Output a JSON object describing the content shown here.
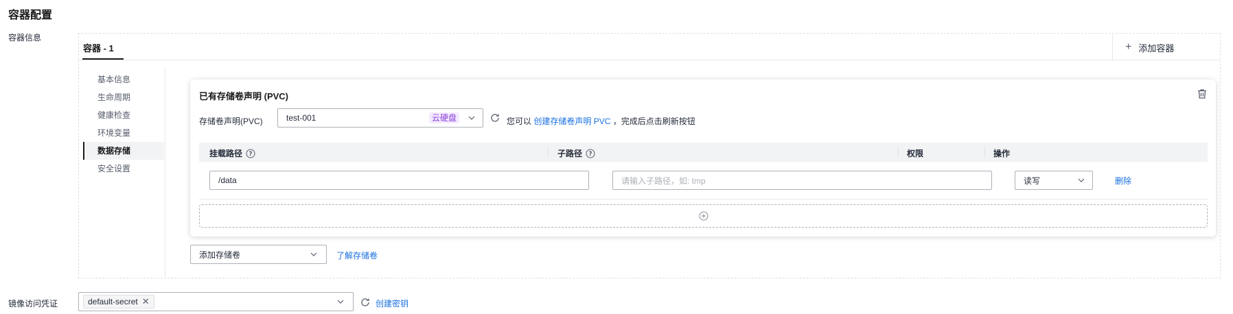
{
  "page": {
    "section_title": "容器配置"
  },
  "container_info": {
    "label": "容器信息",
    "tabs": [
      {
        "label": "容器 - 1",
        "active": true
      }
    ],
    "add_container_label": "添加容器"
  },
  "side_nav": {
    "items": [
      {
        "label": "基本信息",
        "active": false
      },
      {
        "label": "生命周期",
        "active": false
      },
      {
        "label": "健康检查",
        "active": false
      },
      {
        "label": "环境变量",
        "active": false
      },
      {
        "label": "数据存储",
        "active": true
      },
      {
        "label": "安全设置",
        "active": false
      }
    ]
  },
  "pvc_card": {
    "title": "已有存储卷声明 (PVC)",
    "pvc_label": "存储卷声明(PVC)",
    "pvc_value": "test-001",
    "pvc_tag": "云硬盘",
    "hint_prefix": "您可以",
    "hint_link": "创建存储卷声明 PVC",
    "hint_suffix": "，完成后点击刷新按钮",
    "table": {
      "headers": {
        "mount_path": "挂载路径",
        "sub_path": "子路径",
        "permission": "权限",
        "action": "操作"
      },
      "rows": [
        {
          "mount_path": "/data",
          "sub_path_placeholder": "请输入子路径，如: tmp",
          "permission": "读写",
          "action": "删除"
        }
      ]
    }
  },
  "storage": {
    "add_volume_label": "添加存储卷",
    "learn_link": "了解存储卷"
  },
  "image_secret": {
    "label": "镜像访问凭证",
    "chips": [
      "default-secret"
    ],
    "create_link": "创建密钥"
  },
  "colors": {
    "link": "#1a70e0",
    "tag_text": "#8a43d8",
    "tag_bg": "#f5ebff"
  }
}
